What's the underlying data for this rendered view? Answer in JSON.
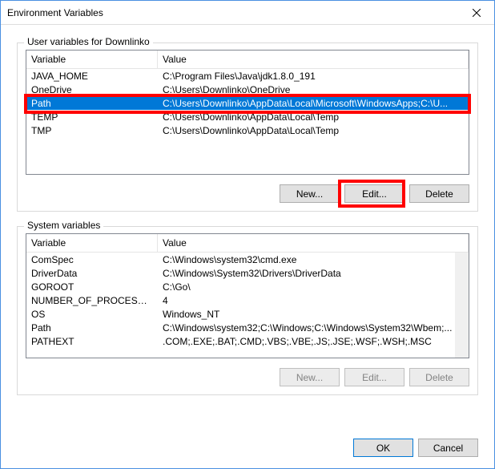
{
  "window": {
    "title": "Environment Variables"
  },
  "userSection": {
    "label": "User variables for Downlinko",
    "columns": {
      "variable": "Variable",
      "value": "Value"
    },
    "rows": [
      {
        "variable": "JAVA_HOME",
        "value": "C:\\Program Files\\Java\\jdk1.8.0_191"
      },
      {
        "variable": "OneDrive",
        "value": "C:\\Users\\Downlinko\\OneDrive"
      },
      {
        "variable": "Path",
        "value": "C:\\Users\\Downlinko\\AppData\\Local\\Microsoft\\WindowsApps;C:\\U..."
      },
      {
        "variable": "TEMP",
        "value": "C:\\Users\\Downlinko\\AppData\\Local\\Temp"
      },
      {
        "variable": "TMP",
        "value": "C:\\Users\\Downlinko\\AppData\\Local\\Temp"
      }
    ],
    "buttons": {
      "new": "New...",
      "edit": "Edit...",
      "delete": "Delete"
    }
  },
  "systemSection": {
    "label": "System variables",
    "columns": {
      "variable": "Variable",
      "value": "Value"
    },
    "rows": [
      {
        "variable": "ComSpec",
        "value": "C:\\Windows\\system32\\cmd.exe"
      },
      {
        "variable": "DriverData",
        "value": "C:\\Windows\\System32\\Drivers\\DriverData"
      },
      {
        "variable": "GOROOT",
        "value": "C:\\Go\\"
      },
      {
        "variable": "NUMBER_OF_PROCESSORS",
        "value": "4"
      },
      {
        "variable": "OS",
        "value": "Windows_NT"
      },
      {
        "variable": "Path",
        "value": "C:\\Windows\\system32;C:\\Windows;C:\\Windows\\System32\\Wbem;..."
      },
      {
        "variable": "PATHEXT",
        "value": ".COM;.EXE;.BAT;.CMD;.VBS;.VBE;.JS;.JSE;.WSF;.WSH;.MSC"
      }
    ],
    "buttons": {
      "new": "New...",
      "edit": "Edit...",
      "delete": "Delete"
    }
  },
  "dialog": {
    "ok": "OK",
    "cancel": "Cancel"
  }
}
